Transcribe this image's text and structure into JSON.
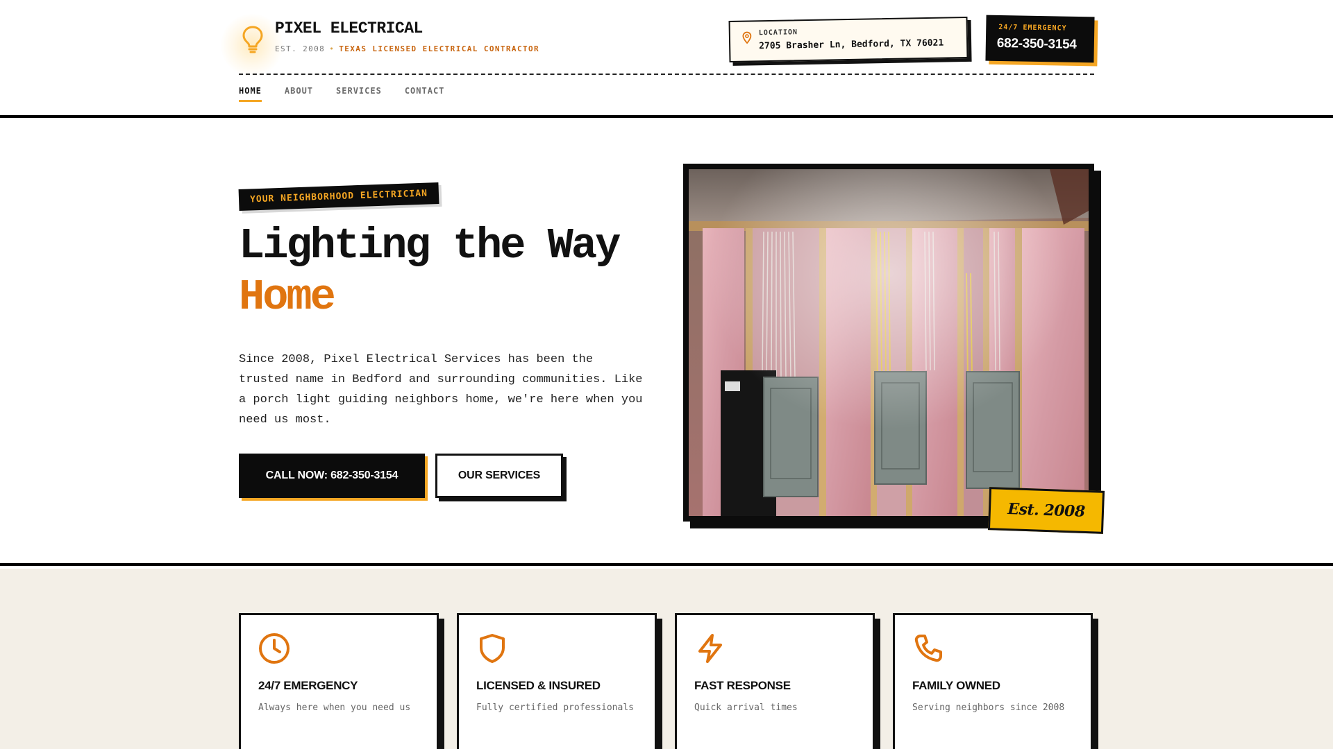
{
  "header": {
    "brand_name": "PIXEL ELECTRICAL",
    "brand_est": "EST. 2008",
    "brand_separator": "•",
    "brand_license": "TEXAS LICENSED ELECTRICAL CONTRACTOR",
    "logo_icon": "lightbulb-icon",
    "location_label": "LOCATION",
    "location_address": "2705 Brasher Ln, Bedford, TX 76021",
    "location_icon": "map-pin-icon",
    "emergency_label": "24/7 EMERGENCY",
    "emergency_phone": "682-350-3154"
  },
  "nav": {
    "items": [
      {
        "label": "HOME",
        "active": true
      },
      {
        "label": "ABOUT",
        "active": false
      },
      {
        "label": "SERVICES",
        "active": false
      },
      {
        "label": "CONTACT",
        "active": false
      }
    ]
  },
  "hero": {
    "tag": "YOUR NEIGHBORHOOD ELECTRICIAN",
    "headline_line1": "Lighting the Way",
    "headline_line2": "Home",
    "text": "Since 2008, Pixel Electrical Services has been the trusted name in Bedford and surrounding communities. Like a porch light guiding neighbors home, we're here when you need us most.",
    "call_button": "CALL NOW: 682-350-3154",
    "services_button": "OUR SERVICES",
    "badge": "Est. 2008"
  },
  "features": [
    {
      "icon": "clock-icon",
      "title": "24/7 EMERGENCY",
      "desc": "Always here when you need us"
    },
    {
      "icon": "shield-icon",
      "title": "LICENSED & INSURED",
      "desc": "Fully certified professionals"
    },
    {
      "icon": "lightning-icon",
      "title": "FAST RESPONSE",
      "desc": "Quick arrival times"
    },
    {
      "icon": "phone-icon",
      "title": "FAMILY OWNED",
      "desc": "Serving neighbors since 2008"
    }
  ],
  "colors": {
    "accent": "#e07510",
    "yellow": "#f5a623",
    "badge": "#f5b800",
    "dark": "#0c0c0c",
    "section_bg": "#f3efe7"
  }
}
